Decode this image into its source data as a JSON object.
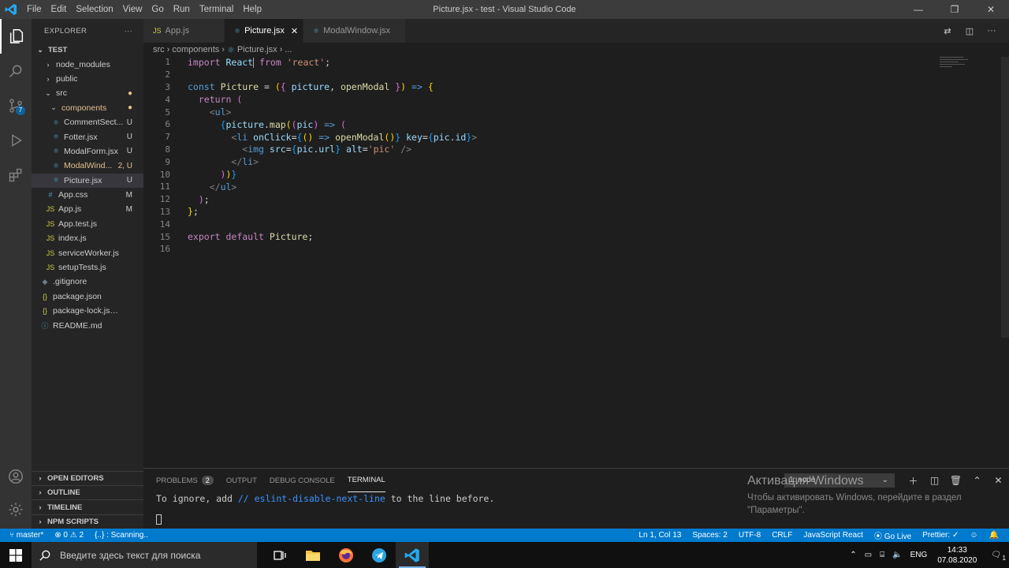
{
  "window": {
    "title": "Picture.jsx - test - Visual Studio Code",
    "menu": [
      "File",
      "Edit",
      "Selection",
      "View",
      "Go",
      "Run",
      "Terminal",
      "Help"
    ]
  },
  "activity": {
    "scm_badge": "7"
  },
  "sidebar": {
    "header": "EXPLORER",
    "more": "···",
    "root": "TEST",
    "items": [
      {
        "label": "node_modules",
        "icon": "chevron-right",
        "status": ""
      },
      {
        "label": "public",
        "icon": "chevron-right",
        "status": ""
      },
      {
        "label": "src",
        "icon": "chevron-down",
        "status": "●"
      },
      {
        "label": "components",
        "icon": "chevron-down",
        "status": "●"
      },
      {
        "label": "CommentSect...",
        "icon": "react-icon",
        "status": "U"
      },
      {
        "label": "Fotter.jsx",
        "icon": "react-icon",
        "status": "U"
      },
      {
        "label": "ModalForm.jsx",
        "icon": "react-icon",
        "status": "U"
      },
      {
        "label": "ModalWind...",
        "icon": "react-icon",
        "status": "2, U"
      },
      {
        "label": "Picture.jsx",
        "icon": "react-icon",
        "status": "U"
      },
      {
        "label": "App.css",
        "icon": "css-icon",
        "status": "M"
      },
      {
        "label": "App.js",
        "icon": "js-icon",
        "status": "M"
      },
      {
        "label": "App.test.js",
        "icon": "js-icon",
        "status": ""
      },
      {
        "label": "index.js",
        "icon": "js-icon",
        "status": ""
      },
      {
        "label": "serviceWorker.js",
        "icon": "js-icon",
        "status": ""
      },
      {
        "label": "setupTests.js",
        "icon": "js-icon",
        "status": ""
      },
      {
        "label": ".gitignore",
        "icon": "dot-icon",
        "status": ""
      },
      {
        "label": "package.json",
        "icon": "json-icon",
        "status": ""
      },
      {
        "label": "package-lock.json",
        "icon": "json-icon",
        "status": ""
      },
      {
        "label": "README.md",
        "icon": "info-icon",
        "status": ""
      }
    ],
    "sections": [
      "OPEN EDITORS",
      "OUTLINE",
      "TIMELINE",
      "NPM SCRIPTS"
    ]
  },
  "tabs": [
    {
      "label": "App.js",
      "icon": "JS",
      "active": false
    },
    {
      "label": "Picture.jsx",
      "icon": "⚛",
      "active": true
    },
    {
      "label": "ModalWindow.jsx",
      "icon": "⚛",
      "active": false
    }
  ],
  "breadcrumb": {
    "p1": "src",
    "p2": "components",
    "p3": "Picture.jsx",
    "p4": "..."
  },
  "editor": {
    "line_numbers": [
      "1",
      "2",
      "3",
      "4",
      "5",
      "6",
      "7",
      "8",
      "9",
      "10",
      "11",
      "12",
      "13",
      "14",
      "15",
      "16"
    ]
  },
  "panel": {
    "tabs": [
      "PROBLEMS",
      "OUTPUT",
      "DEBUG CONSOLE",
      "TERMINAL"
    ],
    "problems_count": "2",
    "terminal_select": "1: node",
    "terminal_text_1": "To ignore, add ",
    "terminal_text_2": "// eslint-disable-next-line",
    "terminal_text_3": " to the line before."
  },
  "watermark": {
    "line1": "Активация Windows",
    "line2": "Чтобы активировать Windows, перейдите в раздел",
    "line3": "\"Параметры\"."
  },
  "status": {
    "branch": "master*",
    "errors": "0",
    "warnings": "2",
    "scanning": "{..} : Scanning..",
    "position": "Ln 1, Col 13",
    "spaces": "Spaces: 2",
    "encoding": "UTF-8",
    "eol": "CRLF",
    "language": "JavaScript React",
    "golive": "Go Live",
    "prettier": "Prettier: ✓"
  },
  "taskbar": {
    "search_placeholder": "Введите здесь текст для поиска",
    "lang": "ENG",
    "time": "14:33",
    "date": "07.08.2020",
    "notif": "1"
  }
}
